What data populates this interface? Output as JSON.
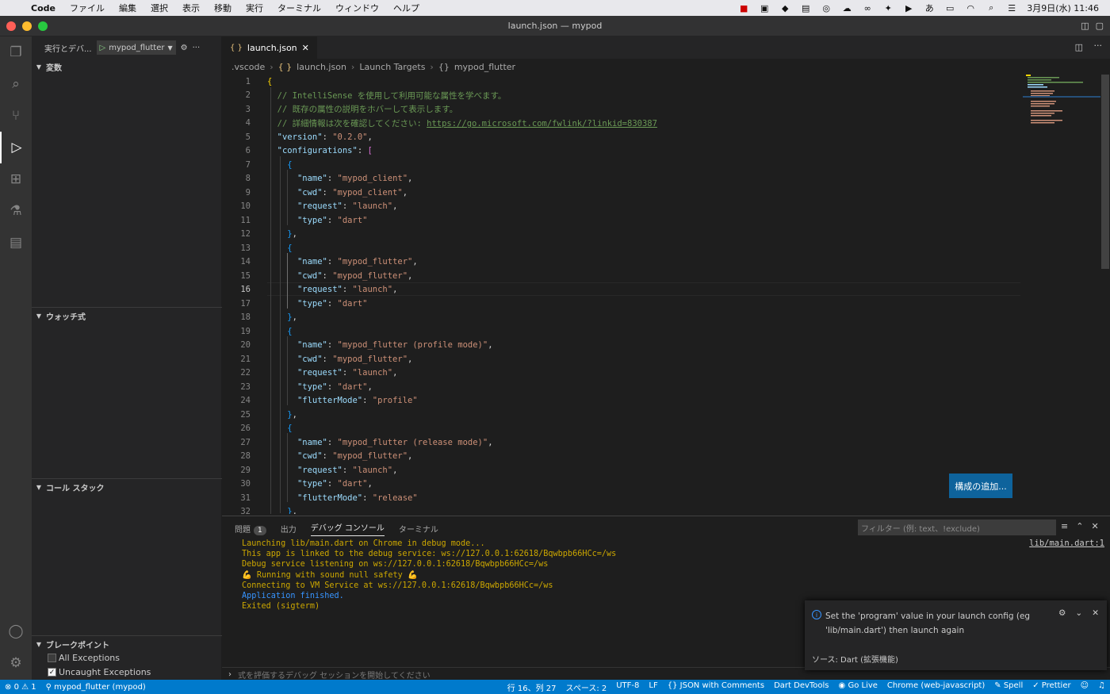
{
  "menubar": {
    "app": "Code",
    "items": [
      "ファイル",
      "編集",
      "選択",
      "表示",
      "移動",
      "実行",
      "ターミナル",
      "ウィンドウ",
      "ヘルプ"
    ],
    "clock": "3月9日(水)  11:46",
    "ime": "あ"
  },
  "window": {
    "title": "launch.json — mypod"
  },
  "sidebar": {
    "header": "実行とデバ...",
    "config_select": "mypod_flutter",
    "sections": {
      "variables": "変数",
      "watch": "ウォッチ式",
      "callstack": "コール スタック",
      "breakpoints": "ブレークポイント"
    },
    "breakpoints": [
      {
        "label": "All Exceptions",
        "checked": false
      },
      {
        "label": "Uncaught Exceptions",
        "checked": true
      }
    ]
  },
  "editor": {
    "tab": "launch.json",
    "breadcrumb": [
      ".vscode",
      "launch.json",
      "Launch Targets",
      "mypod_flutter"
    ],
    "current_line": 16,
    "add_config_button": "構成の追加..."
  },
  "panel": {
    "tabs": {
      "problems": "問題",
      "problems_count": "1",
      "output": "出力",
      "debug": "デバッグ コンソール",
      "terminal": "ターミナル"
    },
    "filter_placeholder": "フィルター (例: text、!exclude)",
    "source_link": "lib/main.dart:1",
    "console": [
      "Launching lib/main.dart on Chrome in debug mode...",
      "This app is linked to the debug service: ws://127.0.0.1:62618/Bqwbpb66HCc=/ws",
      "Debug service listening on ws://127.0.0.1:62618/Bqwbpb66HCc=/ws",
      "💪 Running with sound null safety 💪",
      "Connecting to VM Service at ws://127.0.0.1:62618/Bqwbpb66HCc=/ws",
      "Application finished.",
      "Exited (sigterm)"
    ],
    "repl_placeholder": "式を評価するデバッグ セッションを開始してください"
  },
  "notification": {
    "message": "Set the 'program' value in your launch config (eg 'lib/main.dart') then launch again",
    "source": "ソース: Dart (拡張機能)"
  },
  "statusbar": {
    "errors": "0",
    "warnings": "1",
    "debug_target": "mypod_flutter (mypod)",
    "position": "行 16、列 27",
    "spaces": "スペース: 2",
    "encoding": "UTF-8",
    "eol": "LF",
    "language": "JSON with Comments",
    "items": [
      "Dart DevTools",
      "Go Live",
      "Chrome (web-javascript)",
      "Spell",
      "Prettier"
    ]
  },
  "colors": {
    "accent": "#007acc",
    "button": "#0e639c",
    "console_text": "#cca700",
    "console_info": "#3794ff"
  }
}
